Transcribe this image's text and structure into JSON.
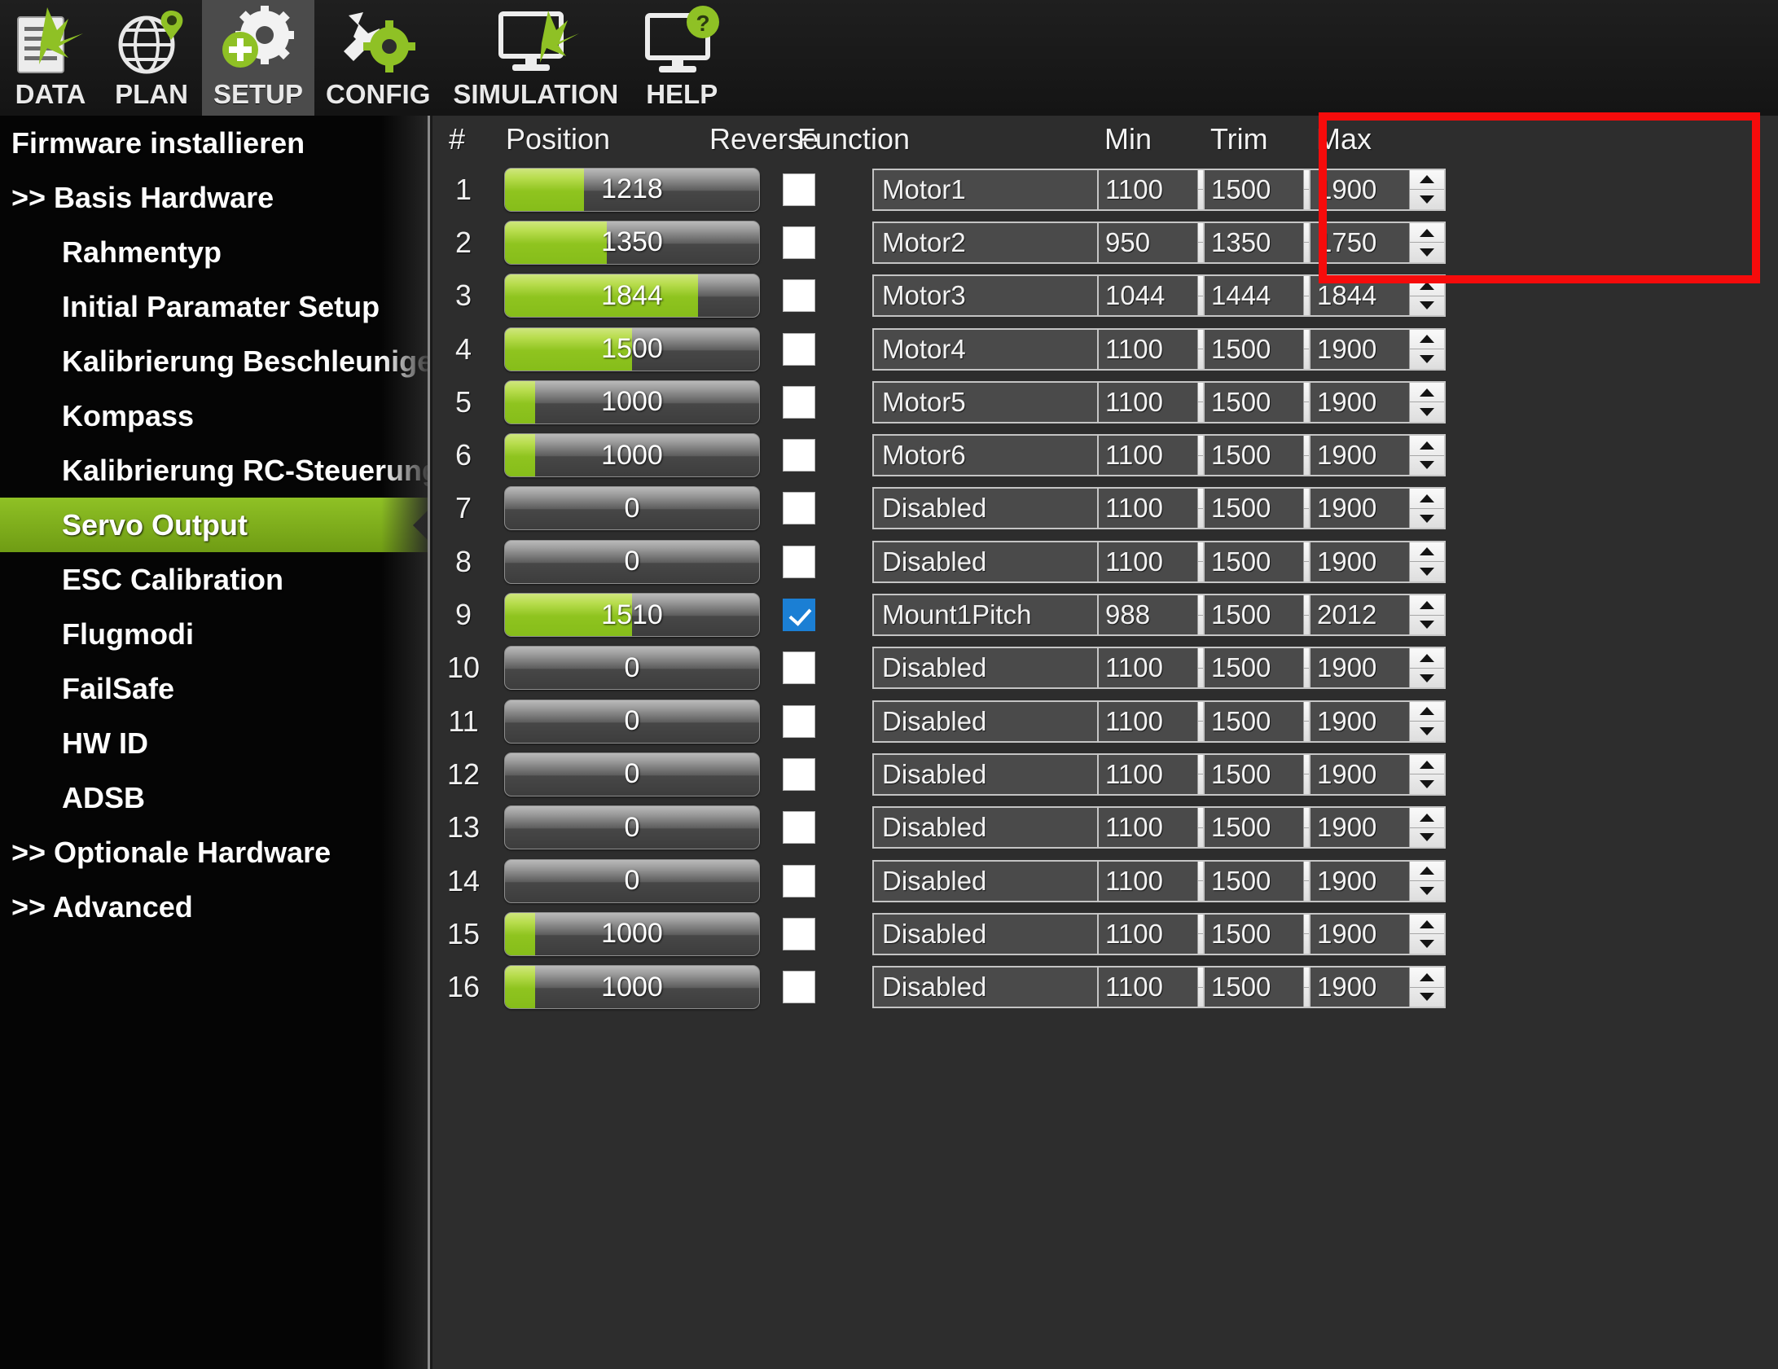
{
  "toolbar": {
    "items": [
      {
        "label": "DATA",
        "icon": "document-plane-icon",
        "active": false
      },
      {
        "label": "PLAN",
        "icon": "globe-pin-icon",
        "active": false
      },
      {
        "label": "SETUP",
        "icon": "gear-plus-icon",
        "active": true
      },
      {
        "label": "CONFIG",
        "icon": "wrench-gear-icon",
        "active": false
      },
      {
        "label": "SIMULATION",
        "icon": "monitor-plane-icon",
        "active": false
      },
      {
        "label": "HELP",
        "icon": "monitor-question-icon",
        "active": false
      }
    ]
  },
  "sidebar": {
    "items": [
      {
        "label": "Firmware installieren",
        "level": 0,
        "selected": false
      },
      {
        "label": ">> Basis Hardware",
        "level": 0,
        "selected": false
      },
      {
        "label": "Rahmentyp",
        "level": 1,
        "selected": false
      },
      {
        "label": "Initial Paramater Setup",
        "level": 1,
        "selected": false
      },
      {
        "label": "Kalibrierung Beschleuniger",
        "level": 1,
        "selected": false
      },
      {
        "label": "Kompass",
        "level": 1,
        "selected": false
      },
      {
        "label": "Kalibrierung RC-Steuerung",
        "level": 1,
        "selected": false
      },
      {
        "label": "Servo Output",
        "level": 1,
        "selected": true
      },
      {
        "label": "ESC Calibration",
        "level": 1,
        "selected": false
      },
      {
        "label": "Flugmodi",
        "level": 1,
        "selected": false
      },
      {
        "label": "FailSafe",
        "level": 1,
        "selected": false
      },
      {
        "label": "HW ID",
        "level": 1,
        "selected": false
      },
      {
        "label": "ADSB",
        "level": 1,
        "selected": false
      },
      {
        "label": ">> Optionale Hardware",
        "level": 0,
        "selected": false
      },
      {
        "label": ">> Advanced",
        "level": 0,
        "selected": false
      }
    ]
  },
  "grid": {
    "headers": {
      "number": "#",
      "position": "Position",
      "reverse": "Reverse",
      "function": "Function",
      "min": "Min",
      "trim": "Trim",
      "max": "Max"
    },
    "rows": [
      {
        "n": "1",
        "position": "1218",
        "fill_pct": 31,
        "reverse": false,
        "function": "Motor1",
        "min": "1100",
        "trim": "1500",
        "max": "1900"
      },
      {
        "n": "2",
        "position": "1350",
        "fill_pct": 40,
        "reverse": false,
        "function": "Motor2",
        "min": "950",
        "trim": "1350",
        "max": "1750"
      },
      {
        "n": "3",
        "position": "1844",
        "fill_pct": 76,
        "reverse": false,
        "function": "Motor3",
        "min": "1044",
        "trim": "1444",
        "max": "1844"
      },
      {
        "n": "4",
        "position": "1500",
        "fill_pct": 50,
        "reverse": false,
        "function": "Motor4",
        "min": "1100",
        "trim": "1500",
        "max": "1900"
      },
      {
        "n": "5",
        "position": "1000",
        "fill_pct": 12,
        "reverse": false,
        "function": "Motor5",
        "min": "1100",
        "trim": "1500",
        "max": "1900"
      },
      {
        "n": "6",
        "position": "1000",
        "fill_pct": 12,
        "reverse": false,
        "function": "Motor6",
        "min": "1100",
        "trim": "1500",
        "max": "1900"
      },
      {
        "n": "7",
        "position": "0",
        "fill_pct": 0,
        "reverse": false,
        "function": "Disabled",
        "min": "1100",
        "trim": "1500",
        "max": "1900"
      },
      {
        "n": "8",
        "position": "0",
        "fill_pct": 0,
        "reverse": false,
        "function": "Disabled",
        "min": "1100",
        "trim": "1500",
        "max": "1900"
      },
      {
        "n": "9",
        "position": "1510",
        "fill_pct": 50,
        "reverse": true,
        "function": "Mount1Pitch",
        "min": "988",
        "trim": "1500",
        "max": "2012"
      },
      {
        "n": "10",
        "position": "0",
        "fill_pct": 0,
        "reverse": false,
        "function": "Disabled",
        "min": "1100",
        "trim": "1500",
        "max": "1900"
      },
      {
        "n": "11",
        "position": "0",
        "fill_pct": 0,
        "reverse": false,
        "function": "Disabled",
        "min": "1100",
        "trim": "1500",
        "max": "1900"
      },
      {
        "n": "12",
        "position": "0",
        "fill_pct": 0,
        "reverse": false,
        "function": "Disabled",
        "min": "1100",
        "trim": "1500",
        "max": "1900"
      },
      {
        "n": "13",
        "position": "0",
        "fill_pct": 0,
        "reverse": false,
        "function": "Disabled",
        "min": "1100",
        "trim": "1500",
        "max": "1900"
      },
      {
        "n": "14",
        "position": "0",
        "fill_pct": 0,
        "reverse": false,
        "function": "Disabled",
        "min": "1100",
        "trim": "1500",
        "max": "1900"
      },
      {
        "n": "15",
        "position": "1000",
        "fill_pct": 12,
        "reverse": false,
        "function": "Disabled",
        "min": "1100",
        "trim": "1500",
        "max": "1900"
      },
      {
        "n": "16",
        "position": "1000",
        "fill_pct": 12,
        "reverse": false,
        "function": "Disabled",
        "min": "1100",
        "trim": "1500",
        "max": "1900"
      }
    ]
  },
  "annotation": {
    "highlight_color": "#f60b0b",
    "highlight_label": "min-trim-max-highlight"
  },
  "colors": {
    "accent_green": "#8fc125",
    "checkbox_blue": "#1b7fd4",
    "panel_bg": "#2d2d2d",
    "sidebar_bg": "#050505"
  }
}
